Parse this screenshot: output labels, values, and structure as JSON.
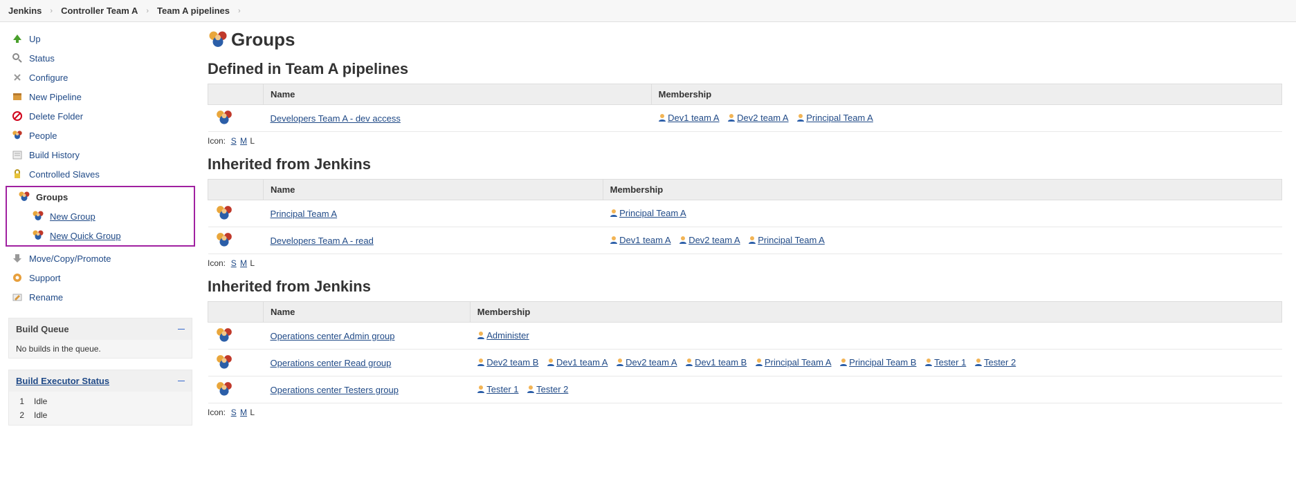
{
  "breadcrumb": [
    {
      "label": "Jenkins"
    },
    {
      "label": "Controller Team A"
    },
    {
      "label": "Team A pipelines"
    }
  ],
  "sidebar": {
    "items": [
      {
        "label": "Up",
        "icon": "up"
      },
      {
        "label": "Status",
        "icon": "search"
      },
      {
        "label": "Configure",
        "icon": "wrench"
      },
      {
        "label": "New Pipeline",
        "icon": "box"
      },
      {
        "label": "Delete Folder",
        "icon": "nope"
      },
      {
        "label": "People",
        "icon": "people"
      },
      {
        "label": "Build History",
        "icon": "history"
      },
      {
        "label": "Controlled Slaves",
        "icon": "lock"
      }
    ],
    "groupsBox": {
      "title": "Groups",
      "children": [
        {
          "label": "New Group"
        },
        {
          "label": "New Quick Group"
        }
      ]
    },
    "itemsAfter": [
      {
        "label": "Move/Copy/Promote",
        "icon": "move"
      },
      {
        "label": "Support",
        "icon": "support"
      },
      {
        "label": "Rename",
        "icon": "rename"
      }
    ],
    "buildQueue": {
      "title": "Build Queue",
      "body": "No builds in the queue."
    },
    "executor": {
      "title": "Build Executor Status",
      "rows": [
        {
          "n": "1",
          "state": "Idle"
        },
        {
          "n": "2",
          "state": "Idle"
        }
      ]
    }
  },
  "page": {
    "title": "Groups",
    "iconSizer": {
      "prefix": "Icon:",
      "sizes": [
        "S",
        "M",
        "L"
      ],
      "current": "L"
    }
  },
  "sections": [
    {
      "title": "Defined in Team A pipelines",
      "headers": {
        "name": "Name",
        "membership": "Membership"
      },
      "rows": [
        {
          "name": "Developers Team A - dev access",
          "members": [
            "Dev1 team A",
            "Dev2 team A",
            "Principal Team A"
          ]
        }
      ]
    },
    {
      "title": "Inherited from Jenkins",
      "headers": {
        "name": "Name",
        "membership": "Membership"
      },
      "rows": [
        {
          "name": "Principal Team A",
          "members": [
            "Principal Team A"
          ]
        },
        {
          "name": "Developers Team A - read",
          "members": [
            "Dev1 team A",
            "Dev2 team A",
            "Principal Team A"
          ]
        }
      ]
    },
    {
      "title": "Inherited from Jenkins",
      "headers": {
        "name": "Name",
        "membership": "Membership"
      },
      "rows": [
        {
          "name": "Operations center Admin group",
          "members": [
            "Administer"
          ]
        },
        {
          "name": "Operations center Read group",
          "members": [
            "Dev2 team B",
            "Dev1 team A",
            "Dev2 team A",
            "Dev1 team B",
            "Principal Team A",
            "Principal Team B",
            "Tester 1",
            "Tester 2"
          ]
        },
        {
          "name": "Operations center Testers group",
          "members": [
            "Tester 1",
            "Tester 2"
          ]
        }
      ]
    }
  ]
}
